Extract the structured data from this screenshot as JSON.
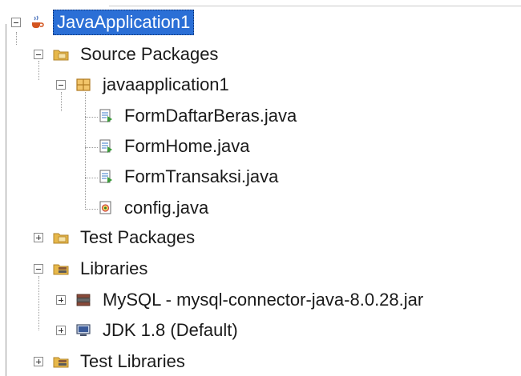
{
  "tree": {
    "project": {
      "label": "JavaApplication1",
      "icon": "java-cup-project-icon"
    },
    "source_packages": {
      "label": "Source Packages",
      "icon": "source-folder-icon"
    },
    "package": {
      "label": "javaapplication1",
      "icon": "package-icon"
    },
    "files": [
      {
        "label": "FormDaftarBeras.java",
        "icon": "java-form-icon"
      },
      {
        "label": "FormHome.java",
        "icon": "java-form-icon"
      },
      {
        "label": "FormTransaksi.java",
        "icon": "java-form-icon"
      },
      {
        "label": "config.java",
        "icon": "java-class-icon"
      }
    ],
    "test_packages": {
      "label": "Test Packages",
      "icon": "test-folder-icon"
    },
    "libraries": {
      "label": "Libraries",
      "icon": "library-folder-icon"
    },
    "library_items": [
      {
        "label": "MySQL - mysql-connector-java-8.0.28.jar",
        "icon": "jar-library-icon"
      },
      {
        "label": "JDK 1.8 (Default)",
        "icon": "jdk-platform-icon"
      }
    ],
    "test_libraries": {
      "label": "Test Libraries",
      "icon": "library-folder-icon"
    }
  },
  "colors": {
    "selection": "#2b6fd6",
    "folder": "#e7b84a",
    "package": "#d89c32",
    "file_green": "#3a9a3a"
  }
}
